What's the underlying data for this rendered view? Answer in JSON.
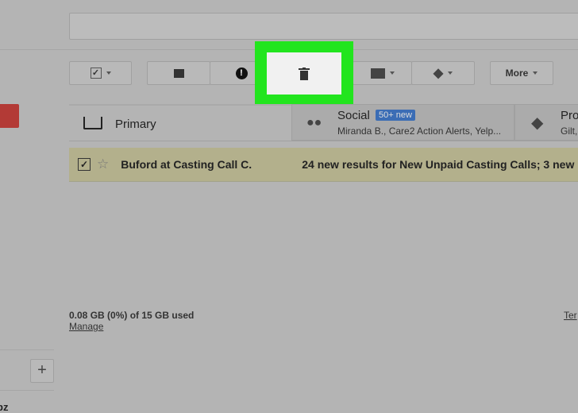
{
  "toolbar": {
    "more_label": "More"
  },
  "tabs": [
    {
      "label": "Primary",
      "icon": "inbox-icon"
    },
    {
      "label": "Social",
      "badge": "50+ new",
      "snippet": "Miranda B., Care2 Action Alerts, Yelp...",
      "icon": "people-icon"
    },
    {
      "label": "Pro",
      "snippet": "Gilt,",
      "icon": "tag-icon"
    }
  ],
  "email": {
    "sender": "Buford at Casting Call C.",
    "subject": "24 new results for New Unpaid Casting Calls; 3 new"
  },
  "footer": {
    "storage": "0.08 GB (0%) of 15 GB used",
    "manage": "Manage",
    "terms": "Ter"
  },
  "sidebar": {
    "bottom_text": "pz"
  },
  "colors": {
    "highlight": "#22e51e",
    "badge": "#3b6db5",
    "compose": "#b33a36"
  }
}
